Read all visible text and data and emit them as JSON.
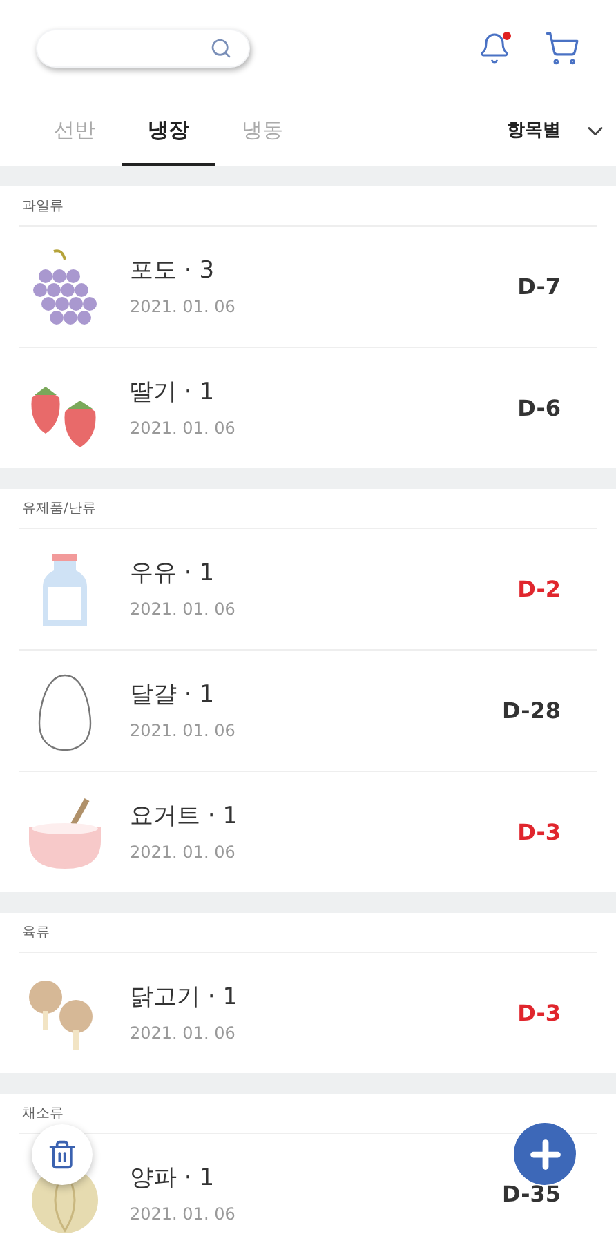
{
  "header": {
    "has_notification": true
  },
  "tabs": [
    {
      "label": "선반",
      "selected": false
    },
    {
      "label": "냉장",
      "selected": true
    },
    {
      "label": "냉동",
      "selected": false
    }
  ],
  "sort": {
    "label": "항목별"
  },
  "sections": [
    {
      "title": "과일류",
      "items": [
        {
          "kind": "grape",
          "name": "포도 · 3",
          "date": "2021. 01. 06",
          "dday": "D-7",
          "urgent": false
        },
        {
          "kind": "strawberry",
          "name": "딸기 · 1",
          "date": "2021. 01. 06",
          "dday": "D-6",
          "urgent": false
        }
      ]
    },
    {
      "title": "유제품/난류",
      "items": [
        {
          "kind": "milk",
          "name": "우유 · 1",
          "date": "2021. 01. 06",
          "dday": "D-2",
          "urgent": true
        },
        {
          "kind": "egg",
          "name": "달걀 · 1",
          "date": "2021. 01. 06",
          "dday": "D-28",
          "urgent": false
        },
        {
          "kind": "yogurt",
          "name": "요거트 · 1",
          "date": "2021. 01. 06",
          "dday": "D-3",
          "urgent": true
        }
      ]
    },
    {
      "title": "육류",
      "items": [
        {
          "kind": "chicken",
          "name": "닭고기 · 1",
          "date": "2021. 01. 06",
          "dday": "D-3",
          "urgent": true
        }
      ]
    },
    {
      "title": "채소류",
      "items": [
        {
          "kind": "onion",
          "name": "양파 · 1",
          "date": "2021. 01. 06",
          "dday": "D-35",
          "urgent": false
        }
      ]
    }
  ]
}
